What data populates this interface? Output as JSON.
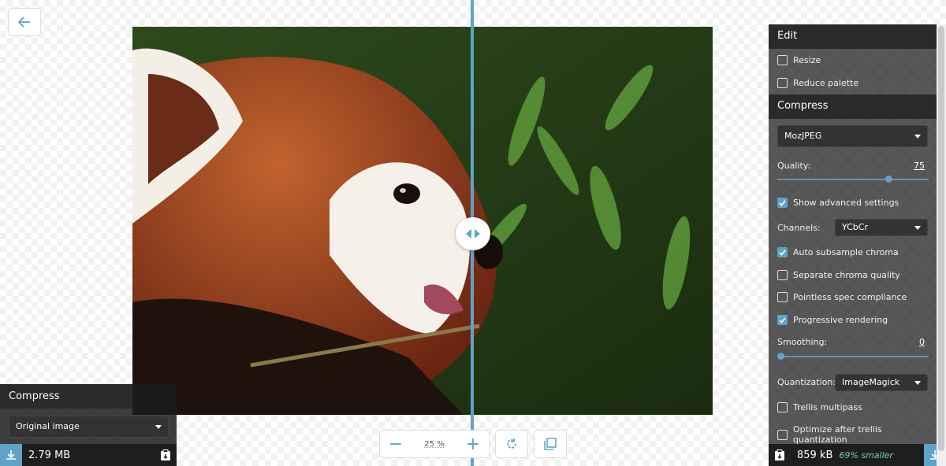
{
  "zoom": {
    "value": "25 %",
    "minus": "−",
    "plus": "+"
  },
  "left_panel": {
    "title": "Compress",
    "method": "Original image",
    "size": "2.79 MB"
  },
  "right_panel": {
    "edit_title": "Edit",
    "resize_label": "Resize",
    "reduce_palette_label": "Reduce palette",
    "compress_title": "Compress",
    "method": "MozJPEG",
    "quality_label": "Quality:",
    "quality_value": "75",
    "quality_fraction": 0.75,
    "show_advanced_label": "Show advanced settings",
    "channels_label": "Channels:",
    "channels_value": "YCbCr",
    "auto_subsample_label": "Auto subsample chroma",
    "separate_chroma_label": "Separate chroma quality",
    "pointless_spec_label": "Pointless spec compliance",
    "progressive_label": "Progressive rendering",
    "smoothing_label": "Smoothing:",
    "smoothing_value": "0",
    "smoothing_fraction": 0,
    "quantization_label": "Quantization:",
    "quantization_value": "ImageMagick",
    "trellis_label": "Trellis multipass",
    "optimize_trellis_label": "Optimize after trellis quantization",
    "size": "859 kB",
    "savings": "69% smaller"
  },
  "checkboxes": {
    "resize": false,
    "reduce_palette": false,
    "show_advanced": true,
    "auto_subsample": true,
    "separate_chroma": false,
    "pointless_spec": false,
    "progressive": true,
    "trellis": false,
    "optimize_trellis": false
  },
  "colors": {
    "accent": "#5fa3c7",
    "savings_green": "#6fd3a5"
  }
}
